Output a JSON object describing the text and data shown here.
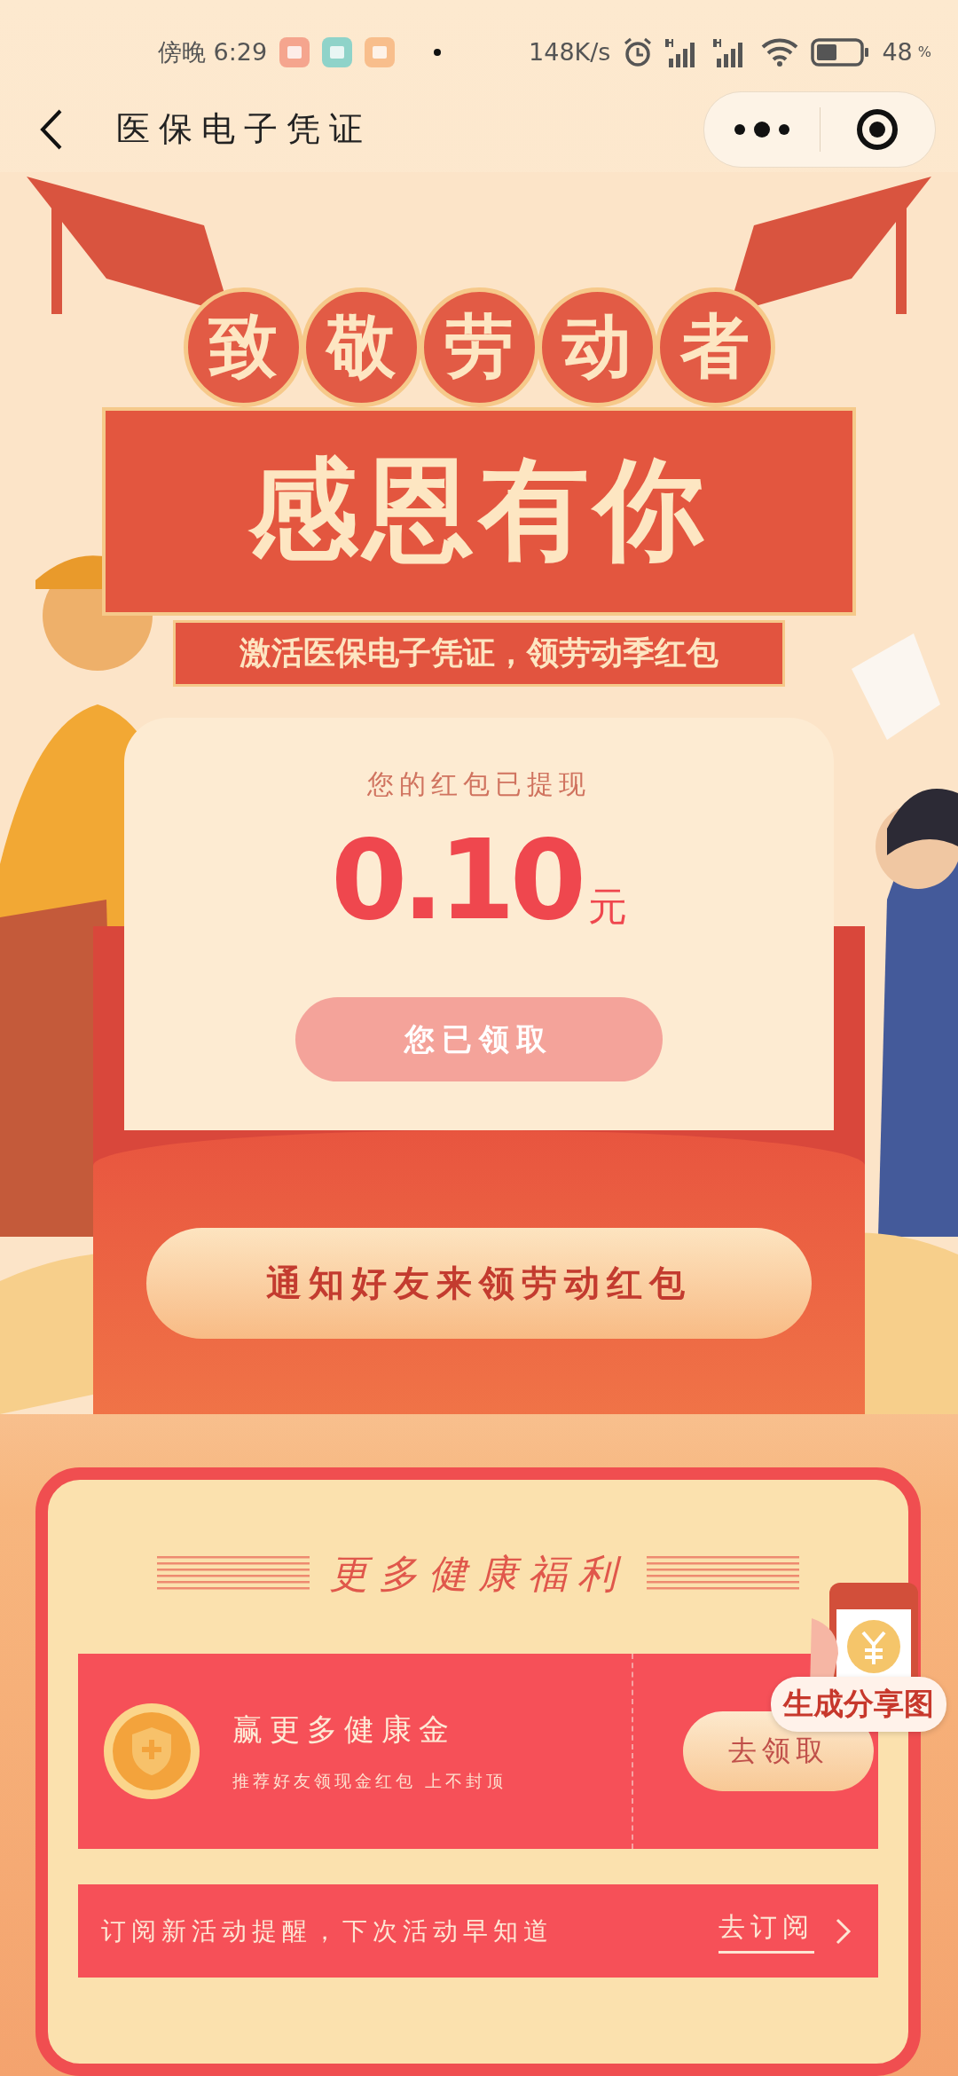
{
  "status_bar": {
    "time": "傍晚 6:29",
    "net_speed": "148K/s",
    "battery_text": "48",
    "battery_unit": "%"
  },
  "nav": {
    "title": "医保电子凭证"
  },
  "banner": {
    "headline": [
      "致",
      "敬",
      "劳",
      "动",
      "者"
    ],
    "slogan": "感恩有你",
    "ribbon": "激活医保电子凭证，领劳动季红包"
  },
  "red_packet": {
    "status": "您的红包已提现",
    "amount": "0.10",
    "unit": "元",
    "claim_button": {
      "label": "您已领取",
      "disabled": true
    },
    "share_button": "通知好友来领劳动红包"
  },
  "benefits": {
    "title": "更多健康福利",
    "items": [
      {
        "title": "赢更多健康金",
        "subtitle": "推荐好友领现金红包 上不封顶",
        "button": "去领取"
      }
    ],
    "subscribe": {
      "text": "订阅新活动提醒，下次活动早知道",
      "link": "去订阅"
    }
  },
  "share_badge": {
    "label": "生成分享图"
  }
}
